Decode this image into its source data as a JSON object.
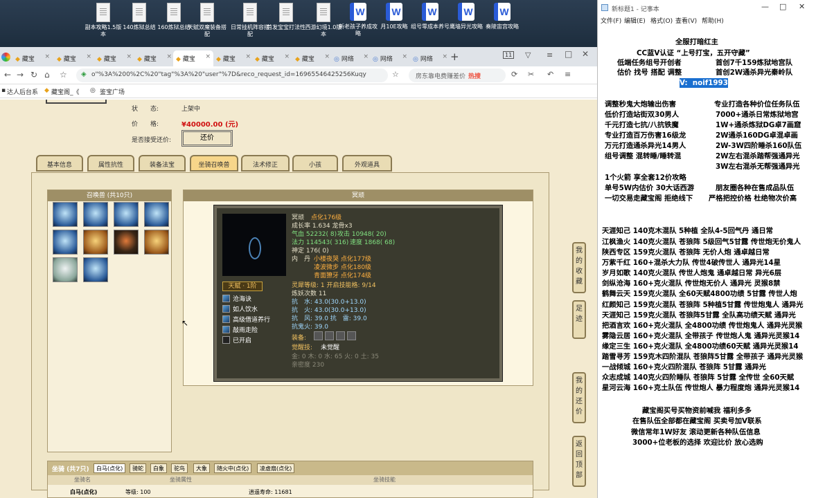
{
  "desktop": {
    "icons": [
      {
        "label": "副本攻略1.5版本",
        "kind": "doc"
      },
      {
        "label": "140炼狱总结",
        "kind": "doc"
      },
      {
        "label": "160炼狱总结",
        "kind": "doc"
      },
      {
        "label": "天赋双魔装备搭配",
        "kind": "doc"
      },
      {
        "label": "日常挂机阵容搭配",
        "kind": "doc"
      },
      {
        "label": "首发宝宝打法性",
        "kind": "doc"
      },
      {
        "label": "西游幻境1.0版本",
        "kind": "doc"
      },
      {
        "label": "新老孩子养成攻略",
        "kind": "word"
      },
      {
        "label": "月10E攻略",
        "kind": "word"
      },
      {
        "label": "组号零成本养号",
        "kind": "word"
      },
      {
        "label": "鹰墙异光攻略",
        "kind": "word"
      },
      {
        "label": "奏陵宙宫攻略",
        "kind": "word"
      }
    ]
  },
  "browser": {
    "tabs": [
      {
        "label": "藏宝",
        "active": false
      },
      {
        "label": "藏宝",
        "active": false
      },
      {
        "label": "藏宝",
        "active": false
      },
      {
        "label": "藏宝",
        "active": false
      },
      {
        "label": "藏宝",
        "active": true
      },
      {
        "label": "藏宝",
        "active": false
      },
      {
        "label": "藏宝",
        "active": false
      },
      {
        "label": "藏宝",
        "active": false
      },
      {
        "label": "网络",
        "active": false
      },
      {
        "label": "网络",
        "active": false
      },
      {
        "label": "网络",
        "active": false
      }
    ],
    "tab_count": "11",
    "url": "o\"%3A%200%2C%20\"tag\"%3A%20\"user\"%7D&reco_request_id=16965546425256Kuqy",
    "search_text": "房东靠电费赚差价",
    "search_badge": "热搜",
    "bookmarks": [
      "达人后台系",
      "藏宝阁_《",
      "鉴宝广场"
    ]
  },
  "listing": {
    "status_label": "状　　态:",
    "status_value": "上架中",
    "price_label": "价　　格:",
    "price_value": "¥40000.00 (元)",
    "bargain_label": "是否接受还价:",
    "bargain_button": "还价"
  },
  "info_tabs": [
    "基本信息",
    "属性抗性",
    "装备法宝",
    "坐骑召唤兽",
    "法术修正",
    "小孩",
    "外观道具"
  ],
  "summons": {
    "header": "召唤兽 (共10只)",
    "detail_header": "冥顽",
    "pets": [
      {
        "kind": "blue"
      },
      {
        "kind": "blue"
      },
      {
        "kind": "blue"
      },
      {
        "kind": "blue"
      },
      {
        "kind": "blue"
      },
      {
        "kind": "gold"
      },
      {
        "kind": "dark"
      },
      {
        "kind": "gold"
      },
      {
        "kind": "pale"
      },
      {
        "kind": "blue"
      }
    ],
    "card": {
      "name": "冥顽",
      "name_note": "点化176级",
      "growth": "成长率 1.634 龙骨x3",
      "hp": "气血 52232( 8)",
      "atk": "攻击 10948( 20)",
      "mp": "法力 114543( 316)",
      "spd": "速度 1868( 68)",
      "spirit": "神定 176( 0)",
      "inner_label": "内　丹",
      "inner1": "小楼夜哭 点化177级",
      "inner2": "凌波微步 点化180级",
      "inner3": "青面獠牙 点化174级",
      "spirit_level": "灵犀等级: 1 开启技能格: 9/14",
      "refine": "炼妖次数 11",
      "resist1": "抗　水: 43.0(30.0+13.0)",
      "resist2": "抗　火: 43.0(30.0+13.0)",
      "resist3": "抗　风: 39.0 抗　雷: 39.0",
      "resist4": "抗鬼火: 39.0",
      "talent": "天赋 · 1阶",
      "skills": [
        "沧海诀",
        "如人饮水",
        "高级借道养行",
        "敲雨走险",
        "已开启"
      ],
      "equip_label": "装备:",
      "awaken_label": "觉醒技:",
      "awaken_value": "未觉醒",
      "elements": "金: 0 木: 0 水: 65 火: 0 土: 35",
      "intimacy": "亲密度 230"
    }
  },
  "side_buttons": [
    "我的收藏",
    "足迹",
    "我的还价",
    "返回顶部"
  ],
  "mounts": {
    "header": "坐骑 (共7只)",
    "tabs": [
      "白马(点化)",
      "骑蛇",
      "白象",
      "驼鸟",
      "大象",
      "随火中(点化)",
      "凌虚扇(点化)"
    ],
    "columns": [
      "坐骑名",
      "坐骑属性",
      "坐骑技能"
    ],
    "row": {
      "name": "白马(点化)",
      "attr": "等级: 100",
      "skill": "逍遥寿命: 11681"
    }
  },
  "notepad": {
    "title": "新标题1 - 记事本",
    "menu": [
      "文件(F)",
      "编辑(E)",
      "格式(O)",
      "查看(V)",
      "帮助(H)"
    ],
    "lines": [
      "全服打暗红主",
      "CC蓝V认证 “上号打宝，五开守藏”",
      "低端任务组号开创者",
      "首创7千159炼狱地宫队",
      "估价 找号 搭配 调整",
      "首创2W通杀异光秦岭队",
      "V:  noif1993",
      "调整秒鬼大炮输出伤害",
      "专业打造各种价位任务队伍",
      "低价打造站街双30男人",
      "7000+通杀日常炼狱地宫",
      "千元打造七抗/八抗铁魔",
      "1W+通杀炼狱DG卓7画窟",
      "专业打造百万伤害16级龙",
      "2W通杀160DG卓混卓画",
      "万元打造通杀异光14男人",
      "2W-3W四阶睡杀160队伍",
      "组号调整 混转睡/睡转混",
      "2W左右混杀踏帮强通异光",
      "3W左右混杀无帮强通异光",
      "1个火箭 享全套12价攻略",
      "单号5W内估价 30大话西游",
      "朋友圈各种在售成品队伍",
      "一切交易走藏宝阁 拒绝线下",
      "严格把控价格 杜绝物次价高",
      "天涯知己 140克木混队 5种植 全队4-5回气丹 通日常",
      "江枫渔火 140克火混队 苍狼阵 5级回气5甘露 传世炮无价鬼人",
      "陕西专区 159克火混队 苍狼阵 无价人炮 通卓越日常",
      "万紫千红 160+混杀大力队 传世4破传世人 通异光14星",
      "岁月如歌 140克火混队 传世人炮鬼 通卓越日常 异光6层",
      "剑纵沧海 160+克火混队 传世炮无价人 通异光 灵猴8禁",
      "鹤舞云天 159克火混队 全60天赋4800功绩 5甘露 传世人炮",
      "红颜知己 159克火混队 苍狼阵 5种植5甘露 传世炮鬼人 通异光",
      "天涯知己 159克火混队 苍狼阵5甘露 全队高功绩天赋 通异光",
      "把酒言欢 160+克火混队 全4800功绩 传世炮鬼人 通异光灵猴",
      "雾隐云居 160+克火混队 全带孩子 传世炮人鬼 通异光灵猴14",
      "缘定三生 160+克火混队 全4800功绩60天赋 通异光灵猴14",
      "踏雪寻芳 159克木四阶混队 苍狼阵5甘露 全带孩子 通异光灵猴",
      "一战倾城 160+克火四阶混队 苍狼阵 5甘露 通异光",
      "众志成城 140克火四阶睡队 苍狼阵 5甘露 全传世 全60天赋",
      "星河云海 160+克土队伍 传世炮人 暴力程度炮 通异光灵猴14",
      "藏宝阁买号买物资前喊我 福利多多",
      "在售队伍全部都在藏宝阁 买卖号加V联系",
      "微信常年1W好友 滚动更新各种队伍信息",
      "3000+位老板的选择 欢迎比价 放心选购"
    ]
  }
}
